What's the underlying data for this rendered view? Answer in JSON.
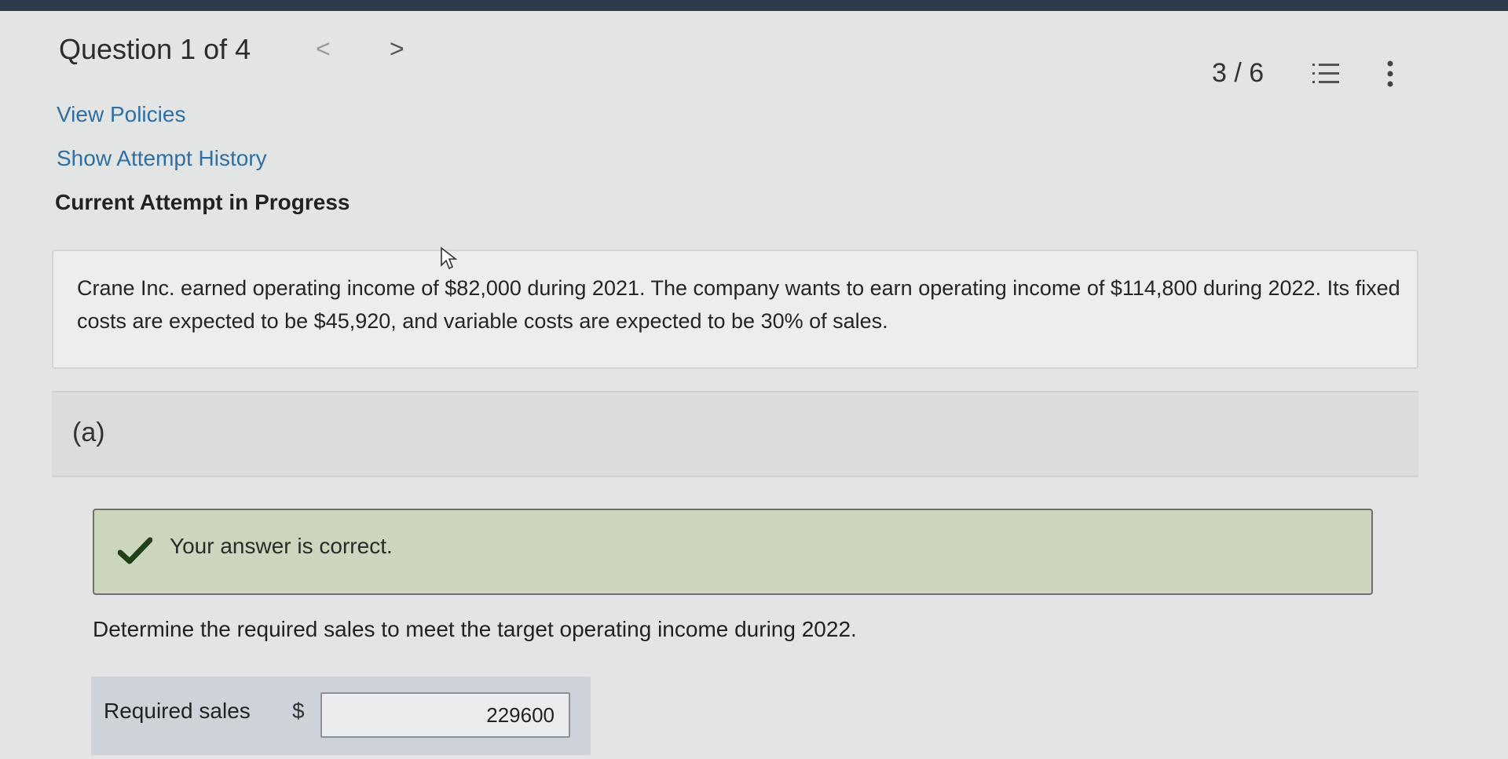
{
  "header": {
    "question_title": "Question 1 of 4",
    "prev_symbol": "<",
    "next_symbol": ">",
    "counter": "3 / 6"
  },
  "links": {
    "view_policies": "View Policies",
    "show_attempt_history": "Show Attempt History"
  },
  "attempt_heading": "Current Attempt in Progress",
  "problem": {
    "text": "Crane Inc. earned operating income of $82,000 during 2021. The company wants to earn operating income of $114,800 during 2022. Its fixed costs are expected to be $45,920, and variable costs are expected to be 30% of sales."
  },
  "part": {
    "label": "(a)"
  },
  "feedback": {
    "message": "Your answer is correct."
  },
  "instruction": "Determine the required sales to meet the target operating income during 2022.",
  "answer": {
    "label": "Required sales",
    "currency_symbol": "$",
    "value": "229600"
  },
  "colors": {
    "link": "#2f6fa3",
    "feedback_bg": "#cbd6bd",
    "check": "#1f3f16",
    "topbar": "#2d3b4c"
  },
  "icons": {
    "list": "numbered-list-icon",
    "more": "more-vertical-icon",
    "check": "check-icon",
    "cursor": "mouse-cursor-icon"
  }
}
